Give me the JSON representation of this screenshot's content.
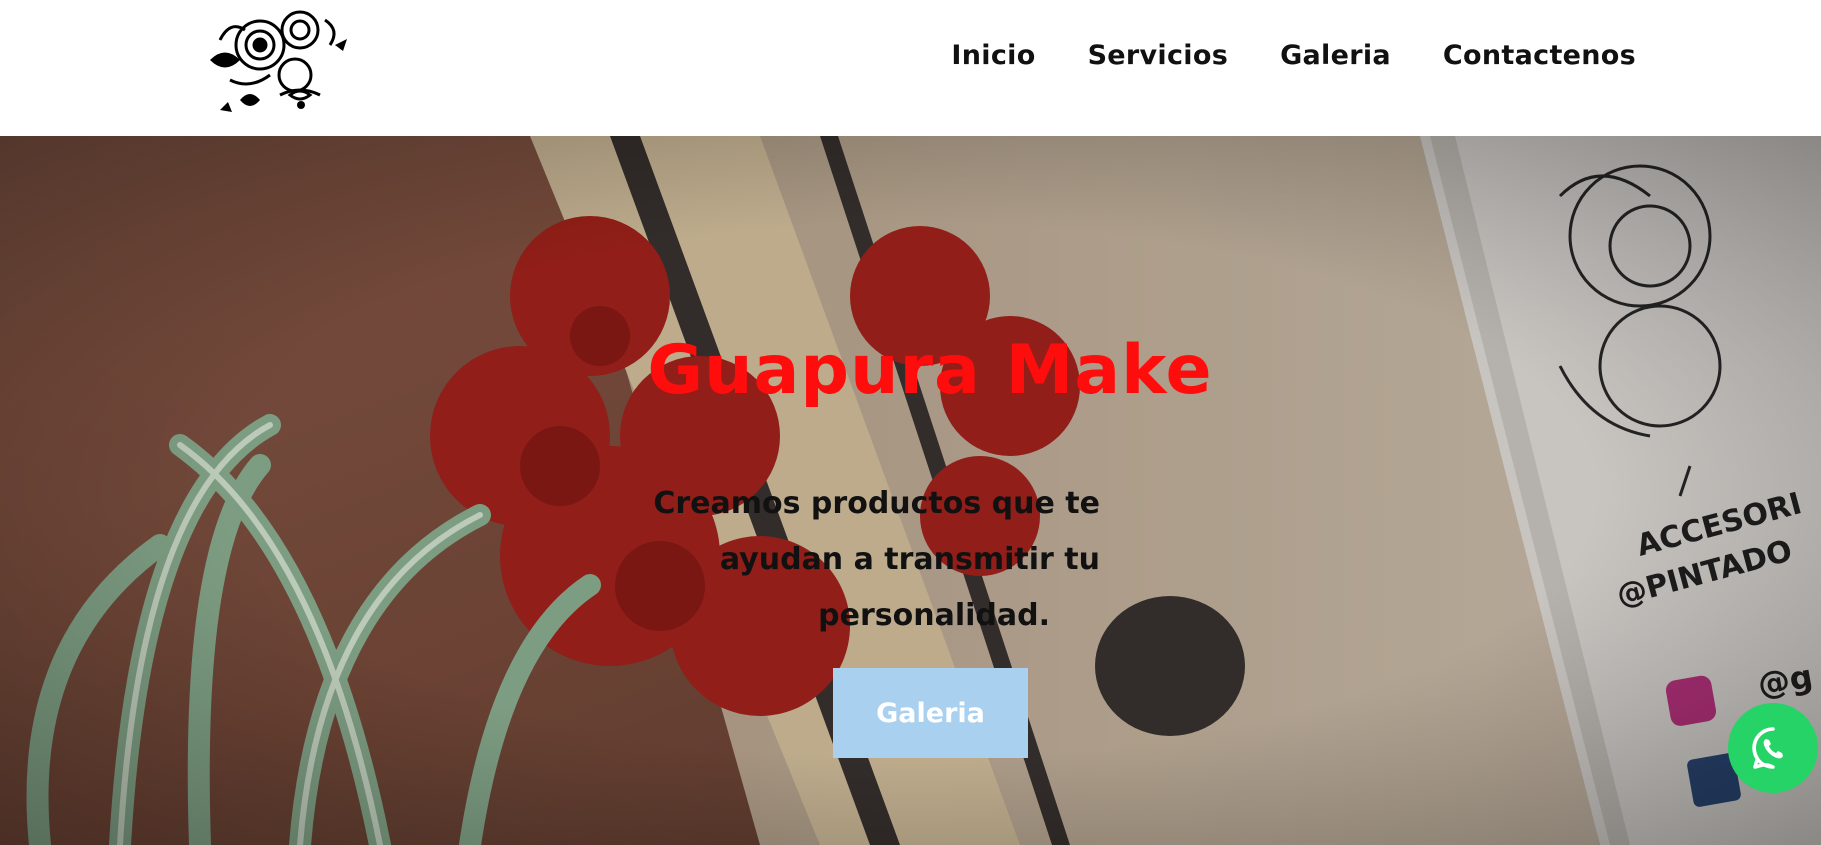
{
  "header": {
    "logo_name": "floral-tattoo-logo",
    "nav": [
      {
        "label": "Inicio"
      },
      {
        "label": "Servicios"
      },
      {
        "label": "Galeria"
      },
      {
        "label": "Contactenos"
      }
    ]
  },
  "hero": {
    "title": "Guapura Make",
    "subtitle_lines": [
      "Creamos productos que te",
      "ayudan a transmitir tu",
      "personalidad."
    ],
    "button_label": "Galeria",
    "background_card_text": [
      "ACCESORI",
      "@PINTADO"
    ],
    "background_card_handle": "@g"
  },
  "floating": {
    "icon": "whatsapp-icon"
  },
  "colors": {
    "title": "#ff0d0d",
    "button_bg": "#a9d1ef",
    "whatsapp": "#25d366"
  }
}
